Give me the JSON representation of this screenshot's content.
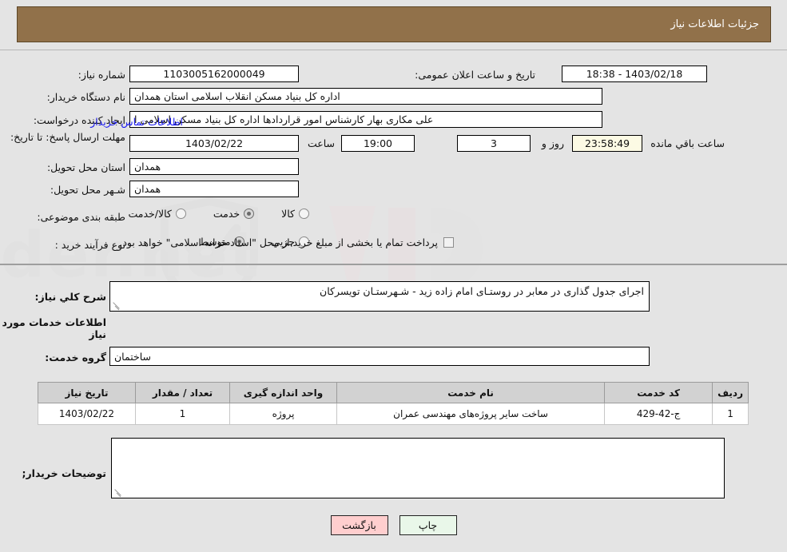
{
  "header": {
    "title": "جزئیات اطلاعات نیاز",
    "bg_color": "#91714a",
    "text_color": "#ffffff"
  },
  "summary": {
    "need_number_label": "شماره نیاز:",
    "need_number_value": "1103005162000049",
    "public_announce_label": "تاریخ و ساعت اعلان عمومی:",
    "public_announce_value": "1403/02/18 - 18:38",
    "buyer_org_label": "نام دستگاه خریدار:",
    "buyer_org_value": "اداره کل بنیاد مسکن انقلاب اسلامی استان همدان",
    "request_creator_label": "ایجاد کننده درخواست:",
    "request_creator_value": "علی مکاری بهار کارشناس امور قراردادها اداره کل بنیاد مسکن اسلامی ا",
    "contact_link": "اطلاعات تماس خریدار",
    "deadline_label": "مهلت ارسال پاسخ: تا تاریخ:",
    "deadline_date": "1403/02/22",
    "deadline_hour_label": "ساعت",
    "deadline_time": "19:00",
    "remaining_days": "3",
    "remaining_days_suffix": "روز و",
    "countdown": "23:58:49",
    "countdown_suffix": "ساعت باقي مانده",
    "province_label": "استان محل تحویل:",
    "province_value": "همدان",
    "city_label": "شـهر محل تحویل:",
    "city_value": "همدان",
    "category_label": "طبقه بندی موضوعی:",
    "category_options": [
      {
        "label": "کالا",
        "selected": false
      },
      {
        "label": "خدمت",
        "selected": true
      },
      {
        "label": "کالا/خدمت",
        "selected": false
      }
    ],
    "purchase_type_label": "نوع فرآیند خرید :",
    "purchase_type_options": [
      {
        "label": "جزیي",
        "selected": false
      },
      {
        "label": "متوسط",
        "selected": true
      }
    ],
    "treasury_checkbox_label": "پرداخت تمام یا بخشی از مبلغ خرید،از محل \"اسناد خزانه اسلامی\" خواهد بود.",
    "treasury_checked": false
  },
  "description": {
    "label": "شرح کلي نیاز:",
    "value": "اجرای جدول گذاری در معابر در روستـای امام زاده زید - شـهرستـان تویسرکان"
  },
  "services": {
    "section_title": "اطلاعات خدمات مورد نیاز",
    "group_label": "گروه خدمت:",
    "group_value": "ساختمان",
    "columns": [
      "ردیف",
      "کد خدمت",
      "نام خدمت",
      "واحد اندازه گیری",
      "تعداد / مقدار",
      "تاریخ نیاز"
    ],
    "rows": [
      {
        "index": "1",
        "code": "ج-42-429",
        "name": "ساخت سایر پروژه‌های مهندسی عمران",
        "unit": "پروژه",
        "quantity": "1",
        "need_date": "1403/02/22"
      }
    ]
  },
  "buyer_notes": {
    "label": "توضیحات خریدار;",
    "value": ""
  },
  "footer": {
    "print_label": "چاپ",
    "back_label": "بازگشت"
  },
  "watermark": {
    "text": "AriaTender.net"
  }
}
